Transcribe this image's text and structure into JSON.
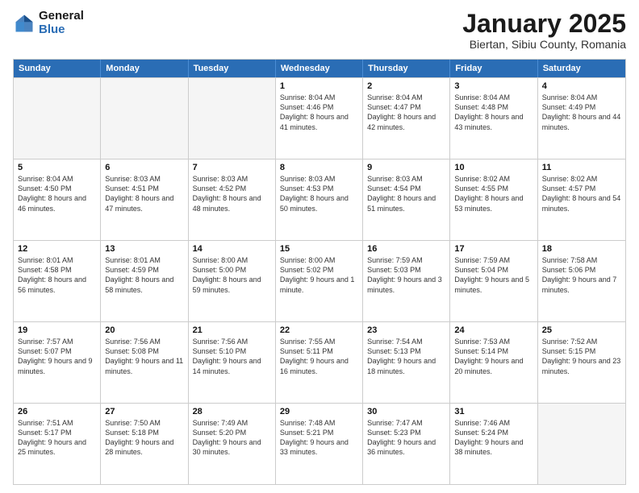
{
  "logo": {
    "general": "General",
    "blue": "Blue"
  },
  "header": {
    "month": "January 2025",
    "location": "Biertan, Sibiu County, Romania"
  },
  "weekdays": [
    "Sunday",
    "Monday",
    "Tuesday",
    "Wednesday",
    "Thursday",
    "Friday",
    "Saturday"
  ],
  "rows": [
    [
      {
        "day": "",
        "info": "",
        "empty": true
      },
      {
        "day": "",
        "info": "",
        "empty": true
      },
      {
        "day": "",
        "info": "",
        "empty": true
      },
      {
        "day": "1",
        "info": "Sunrise: 8:04 AM\nSunset: 4:46 PM\nDaylight: 8 hours and 41 minutes."
      },
      {
        "day": "2",
        "info": "Sunrise: 8:04 AM\nSunset: 4:47 PM\nDaylight: 8 hours and 42 minutes."
      },
      {
        "day": "3",
        "info": "Sunrise: 8:04 AM\nSunset: 4:48 PM\nDaylight: 8 hours and 43 minutes."
      },
      {
        "day": "4",
        "info": "Sunrise: 8:04 AM\nSunset: 4:49 PM\nDaylight: 8 hours and 44 minutes."
      }
    ],
    [
      {
        "day": "5",
        "info": "Sunrise: 8:04 AM\nSunset: 4:50 PM\nDaylight: 8 hours and 46 minutes."
      },
      {
        "day": "6",
        "info": "Sunrise: 8:03 AM\nSunset: 4:51 PM\nDaylight: 8 hours and 47 minutes."
      },
      {
        "day": "7",
        "info": "Sunrise: 8:03 AM\nSunset: 4:52 PM\nDaylight: 8 hours and 48 minutes."
      },
      {
        "day": "8",
        "info": "Sunrise: 8:03 AM\nSunset: 4:53 PM\nDaylight: 8 hours and 50 minutes."
      },
      {
        "day": "9",
        "info": "Sunrise: 8:03 AM\nSunset: 4:54 PM\nDaylight: 8 hours and 51 minutes."
      },
      {
        "day": "10",
        "info": "Sunrise: 8:02 AM\nSunset: 4:55 PM\nDaylight: 8 hours and 53 minutes."
      },
      {
        "day": "11",
        "info": "Sunrise: 8:02 AM\nSunset: 4:57 PM\nDaylight: 8 hours and 54 minutes."
      }
    ],
    [
      {
        "day": "12",
        "info": "Sunrise: 8:01 AM\nSunset: 4:58 PM\nDaylight: 8 hours and 56 minutes."
      },
      {
        "day": "13",
        "info": "Sunrise: 8:01 AM\nSunset: 4:59 PM\nDaylight: 8 hours and 58 minutes."
      },
      {
        "day": "14",
        "info": "Sunrise: 8:00 AM\nSunset: 5:00 PM\nDaylight: 8 hours and 59 minutes."
      },
      {
        "day": "15",
        "info": "Sunrise: 8:00 AM\nSunset: 5:02 PM\nDaylight: 9 hours and 1 minute."
      },
      {
        "day": "16",
        "info": "Sunrise: 7:59 AM\nSunset: 5:03 PM\nDaylight: 9 hours and 3 minutes."
      },
      {
        "day": "17",
        "info": "Sunrise: 7:59 AM\nSunset: 5:04 PM\nDaylight: 9 hours and 5 minutes."
      },
      {
        "day": "18",
        "info": "Sunrise: 7:58 AM\nSunset: 5:06 PM\nDaylight: 9 hours and 7 minutes."
      }
    ],
    [
      {
        "day": "19",
        "info": "Sunrise: 7:57 AM\nSunset: 5:07 PM\nDaylight: 9 hours and 9 minutes."
      },
      {
        "day": "20",
        "info": "Sunrise: 7:56 AM\nSunset: 5:08 PM\nDaylight: 9 hours and 11 minutes."
      },
      {
        "day": "21",
        "info": "Sunrise: 7:56 AM\nSunset: 5:10 PM\nDaylight: 9 hours and 14 minutes."
      },
      {
        "day": "22",
        "info": "Sunrise: 7:55 AM\nSunset: 5:11 PM\nDaylight: 9 hours and 16 minutes."
      },
      {
        "day": "23",
        "info": "Sunrise: 7:54 AM\nSunset: 5:13 PM\nDaylight: 9 hours and 18 minutes."
      },
      {
        "day": "24",
        "info": "Sunrise: 7:53 AM\nSunset: 5:14 PM\nDaylight: 9 hours and 20 minutes."
      },
      {
        "day": "25",
        "info": "Sunrise: 7:52 AM\nSunset: 5:15 PM\nDaylight: 9 hours and 23 minutes."
      }
    ],
    [
      {
        "day": "26",
        "info": "Sunrise: 7:51 AM\nSunset: 5:17 PM\nDaylight: 9 hours and 25 minutes."
      },
      {
        "day": "27",
        "info": "Sunrise: 7:50 AM\nSunset: 5:18 PM\nDaylight: 9 hours and 28 minutes."
      },
      {
        "day": "28",
        "info": "Sunrise: 7:49 AM\nSunset: 5:20 PM\nDaylight: 9 hours and 30 minutes."
      },
      {
        "day": "29",
        "info": "Sunrise: 7:48 AM\nSunset: 5:21 PM\nDaylight: 9 hours and 33 minutes."
      },
      {
        "day": "30",
        "info": "Sunrise: 7:47 AM\nSunset: 5:23 PM\nDaylight: 9 hours and 36 minutes."
      },
      {
        "day": "31",
        "info": "Sunrise: 7:46 AM\nSunset: 5:24 PM\nDaylight: 9 hours and 38 minutes."
      },
      {
        "day": "",
        "info": "",
        "empty": true
      }
    ]
  ]
}
